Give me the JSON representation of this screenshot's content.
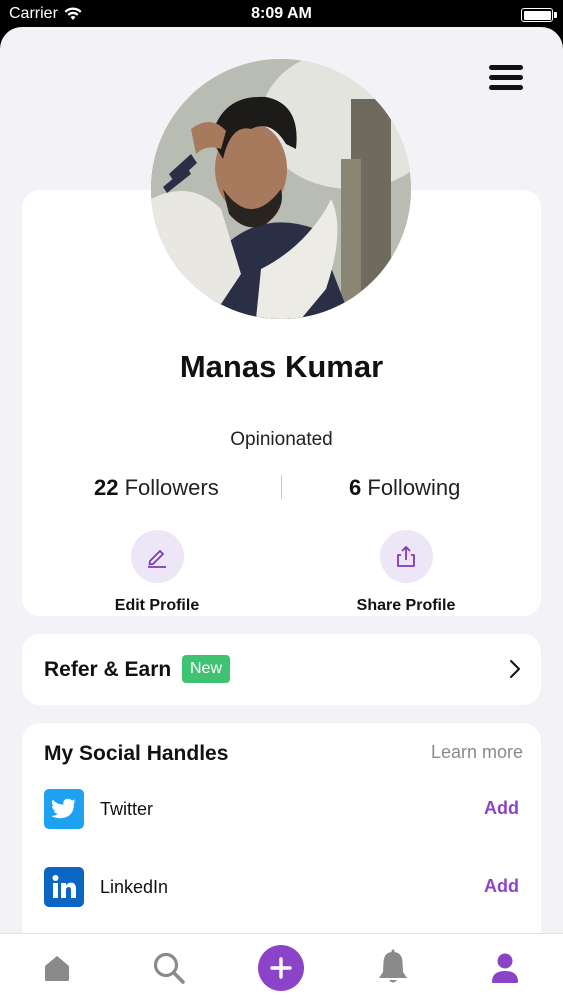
{
  "status_bar": {
    "carrier": "Carrier",
    "time": "8:09 AM",
    "battery_percent": 100
  },
  "profile": {
    "name": "Manas Kumar",
    "bio": "Opinionated",
    "followers_count": "22",
    "followers_label": "Followers",
    "following_count": "6",
    "following_label": "Following"
  },
  "actions": {
    "edit_label": "Edit Profile",
    "share_label": "Share Profile"
  },
  "refer": {
    "title": "Refer & Earn",
    "badge": "New"
  },
  "social": {
    "title": "My Social Handles",
    "learn_more": "Learn more",
    "items": [
      {
        "name": "Twitter",
        "action": "Add",
        "icon": "twitter-icon"
      },
      {
        "name": "LinkedIn",
        "action": "Add",
        "icon": "linkedin-icon"
      }
    ]
  },
  "tabbar": {
    "items": [
      "home-icon",
      "search-icon",
      "plus-icon",
      "bell-icon",
      "user-icon"
    ]
  },
  "colors": {
    "accent": "#8b44c8",
    "badge_green": "#3fc372",
    "action_circle": "#ece6f7",
    "twitter": "#1da1f2",
    "linkedin": "#0a66c2",
    "background": "#f3f2f7"
  }
}
